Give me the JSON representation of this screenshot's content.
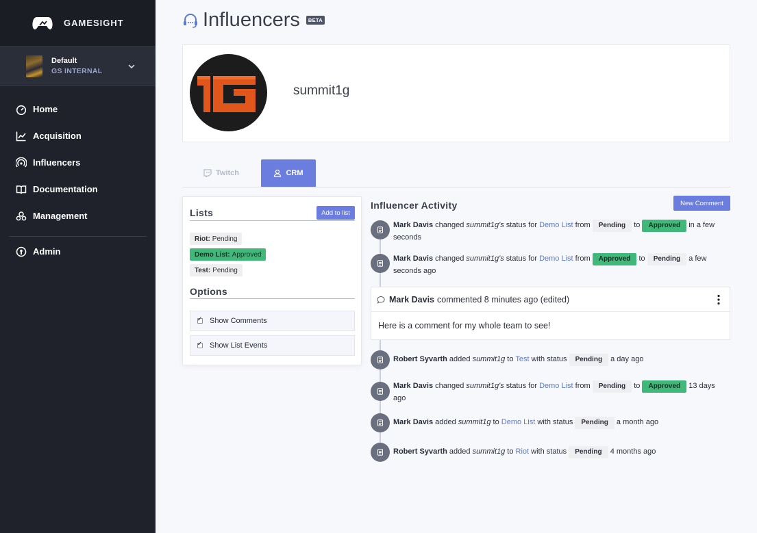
{
  "brand": {
    "name": "GAMESIGHT"
  },
  "account": {
    "name": "Default",
    "org": "GS INTERNAL"
  },
  "nav": [
    {
      "label": "Home",
      "icon": "gauge-icon"
    },
    {
      "label": "Acquisition",
      "icon": "chart-line-icon"
    },
    {
      "label": "Influencers",
      "icon": "broadcast-icon"
    },
    {
      "label": "Documentation",
      "icon": "book-icon"
    },
    {
      "label": "Management",
      "icon": "users-icon"
    },
    {
      "label": "Admin",
      "icon": "admin-icon"
    }
  ],
  "page": {
    "title": "Influencers",
    "badge": "BETA"
  },
  "profile": {
    "name": "summit1g",
    "avatar_text": "1G"
  },
  "tabs": {
    "twitch": "Twitch",
    "crm": "CRM"
  },
  "lists_card": {
    "title": "Lists",
    "add_button": "Add to list",
    "lists": [
      {
        "name": "Riot:",
        "status": "Pending"
      },
      {
        "name": "Demo List:",
        "status": "Approved"
      },
      {
        "name": "Test:",
        "status": "Pending"
      }
    ],
    "options_title": "Options",
    "options": [
      {
        "label": "Show Comments",
        "checked": true
      },
      {
        "label": "Show List Events",
        "checked": true
      }
    ]
  },
  "activity": {
    "title": "Influencer Activity",
    "new_comment": "New Comment",
    "events": [
      {
        "user": "Mark Davis",
        "verb": " changed ",
        "subject": "summit1g's",
        "mid": " status for ",
        "list": "Demo List",
        "from_word": " from ",
        "from": "Pending",
        "to_word": " to ",
        "to": "Approved",
        "time": " in a few seconds"
      },
      {
        "user": "Mark Davis",
        "verb": " changed ",
        "subject": "summit1g's",
        "mid": " status for ",
        "list": "Demo List",
        "from_word": " from ",
        "from": "Approved",
        "to_word": " to ",
        "to": "Pending",
        "time": " a few seconds ago"
      },
      {
        "user": "Robert Syvarth",
        "verb": " added ",
        "subject": "summit1g",
        "mid": " to ",
        "list": "Test",
        "with": " with status ",
        "status": "Pending",
        "time": " a day ago"
      },
      {
        "user": "Mark Davis",
        "verb": " changed ",
        "subject": "summit1g's",
        "mid": " status for ",
        "list": "Demo List",
        "from_word": " from ",
        "from": "Pending",
        "to_word": " to ",
        "to": "Approved",
        "time": " 13 days ago"
      },
      {
        "user": "Mark Davis",
        "verb": " added ",
        "subject": "summit1g",
        "mid": " to ",
        "list": "Demo List",
        "with": " with status ",
        "status": "Pending",
        "time": " a month ago"
      },
      {
        "user": "Robert Syvarth",
        "verb": " added ",
        "subject": "summit1g",
        "mid": " to ",
        "list": "Riot",
        "with": " with status ",
        "status": "Pending",
        "time": " 4 months ago"
      }
    ],
    "comment": {
      "user": "Mark Davis",
      "meta": "commented 8 minutes ago (edited)",
      "body": "Here is a comment for my whole team to see!"
    }
  },
  "colors": {
    "accent": "#6b7ee0",
    "approved": "#3fb87a",
    "sidebar": "#1f222b"
  }
}
